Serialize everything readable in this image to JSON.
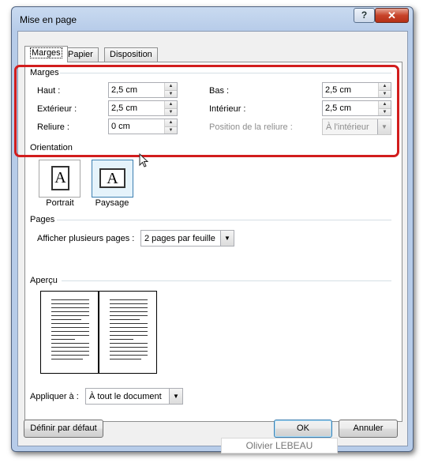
{
  "window": {
    "title": "Mise en page",
    "help_label": "?",
    "close_label": "✕"
  },
  "tabs": [
    {
      "label": "Marges"
    },
    {
      "label": "Papier"
    },
    {
      "label": "Disposition"
    }
  ],
  "marges": {
    "group_label": "Marges",
    "haut": {
      "label": "Haut :",
      "value": "2,5 cm"
    },
    "bas": {
      "label": "Bas :",
      "value": "2,5 cm"
    },
    "exterieur": {
      "label": "Extérieur :",
      "value": "2,5 cm"
    },
    "interieur": {
      "label": "Intérieur :",
      "value": "2,5 cm"
    },
    "reliure": {
      "label": "Reliure :",
      "value": "0 cm"
    },
    "position_reliure": {
      "label": "Position de la reliure :",
      "value": "À l'intérieur"
    }
  },
  "orientation": {
    "group_label": "Orientation",
    "portrait": {
      "label": "Portrait",
      "glyph": "A"
    },
    "paysage": {
      "label": "Paysage",
      "glyph": "A"
    }
  },
  "pages": {
    "group_label": "Pages",
    "afficher_label": "Afficher plusieurs pages :",
    "afficher_value": "2 pages par feuille"
  },
  "apercu": {
    "group_label": "Aperçu"
  },
  "appliquer": {
    "label": "Appliquer à :",
    "value": "À tout le document"
  },
  "buttons": {
    "definir": "Définir par défaut",
    "ok": "OK",
    "annuler": "Annuler"
  },
  "watermark": "Olivier LEBEAU",
  "colors": {
    "highlight": "#d21d1d",
    "accent_blue": "#3c7fb1",
    "title_bar": "#b7cce9"
  },
  "icons": {
    "spin_up": "▲",
    "spin_down": "▼",
    "dropdown": "▼"
  }
}
